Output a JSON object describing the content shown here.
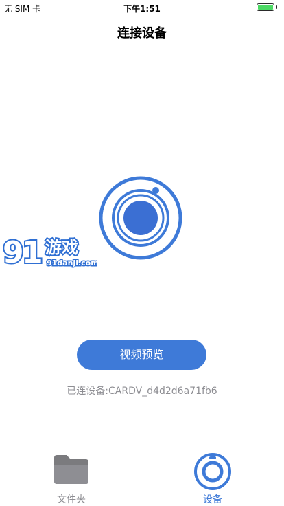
{
  "status_bar": {
    "carrier": "无 SIM 卡",
    "time": "下午1:51",
    "battery_level": 1.0,
    "battery_color": "#4cd964"
  },
  "nav": {
    "title": "连接设备"
  },
  "main": {
    "device_icon": "camera-lens-icon",
    "preview_button_label": "视频预览",
    "connected_device_text": "已连设备:CARDV_d4d2d6a71fb6"
  },
  "watermark": {
    "logo_text": "91游戏",
    "url_text": "91danji.com"
  },
  "tab_bar": {
    "tabs": [
      {
        "label": "文件夹",
        "icon": "folder-icon",
        "active": false
      },
      {
        "label": "设备",
        "icon": "camera-lens-icon",
        "active": true
      }
    ]
  },
  "colors": {
    "accent": "#3e7ad8",
    "inactive": "#8e8e93"
  }
}
